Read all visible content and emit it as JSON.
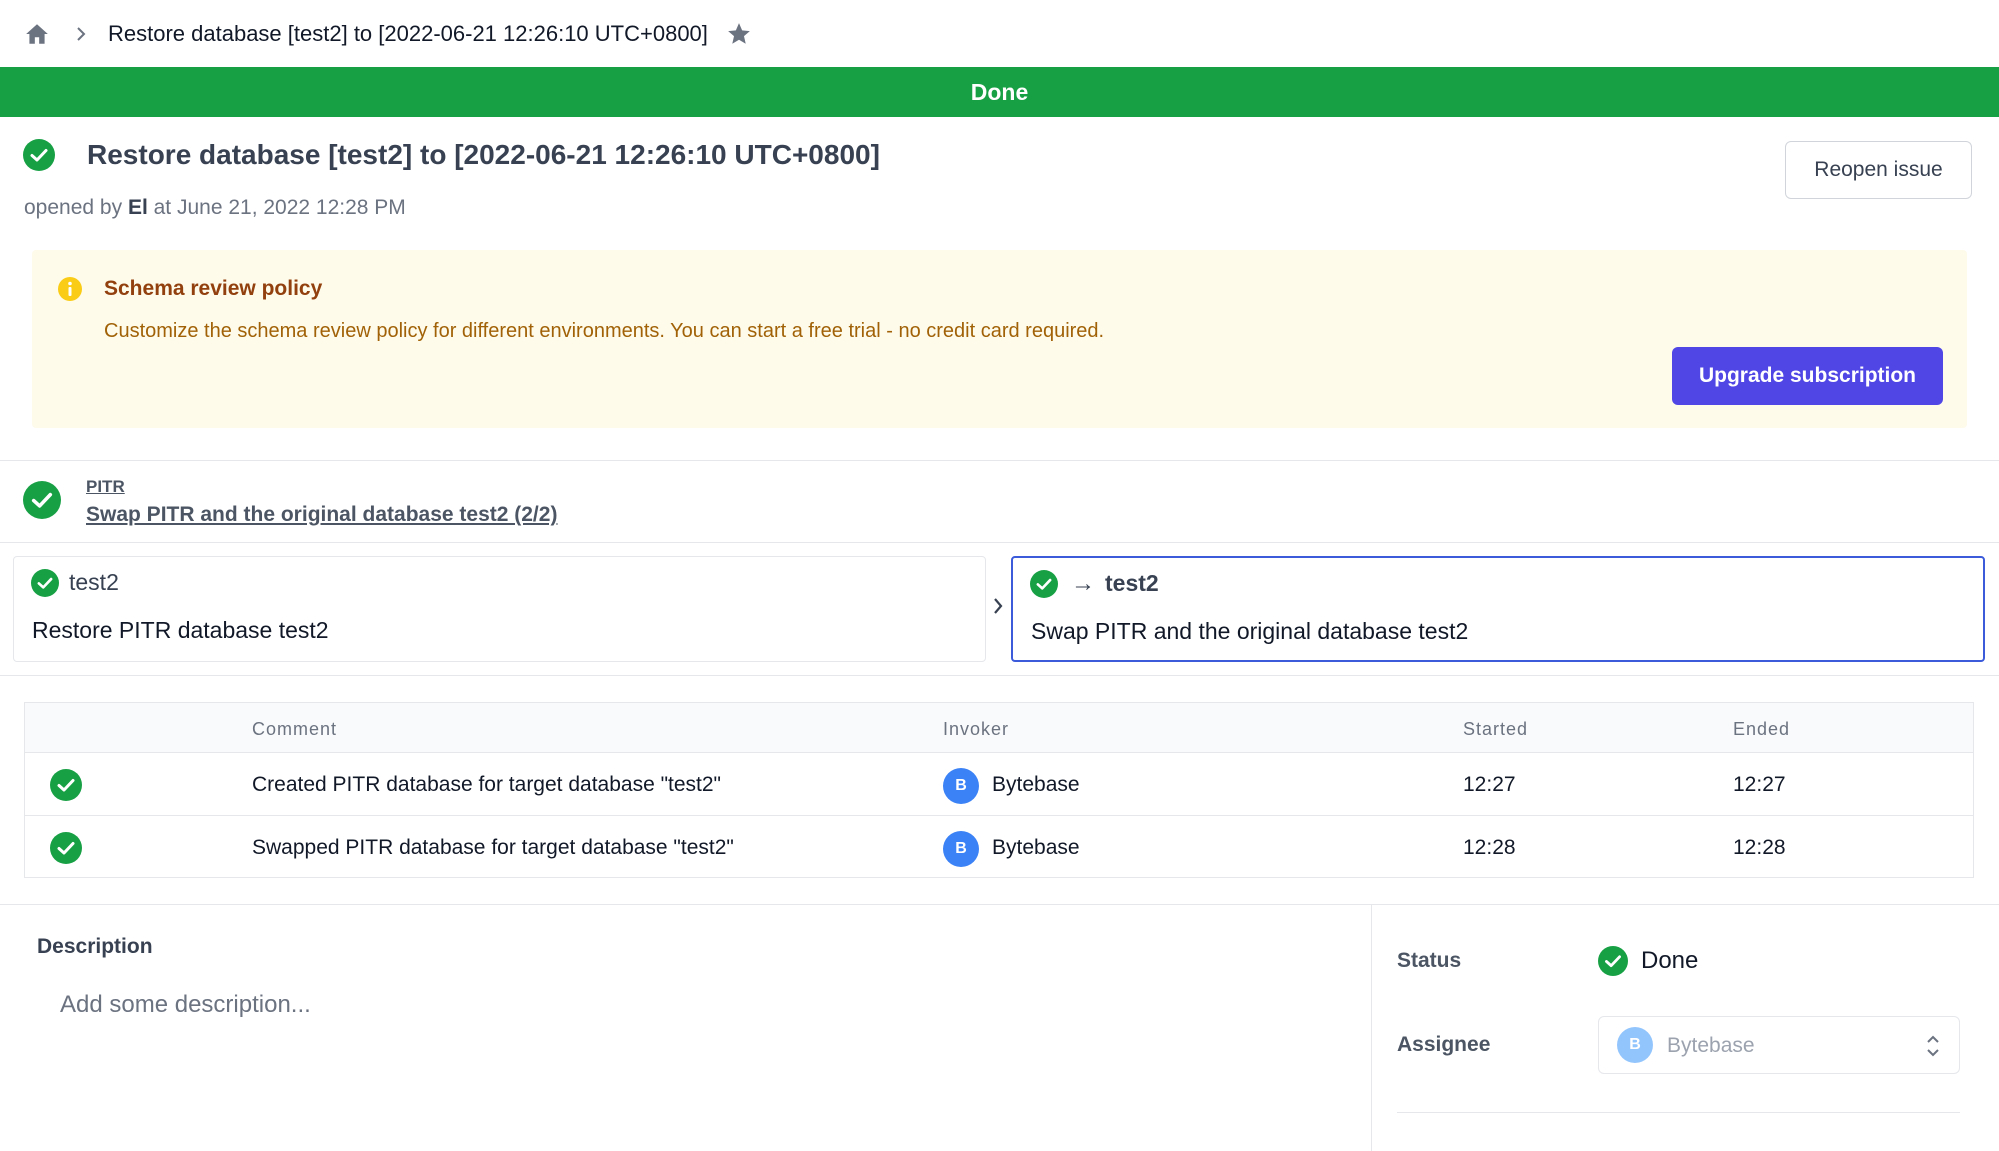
{
  "breadcrumb": {
    "current": "Restore database [test2] to [2022-06-21 12:26:10 UTC+0800]"
  },
  "banner": {
    "status": "Done"
  },
  "issue": {
    "title": "Restore database [test2] to [2022-06-21 12:26:10 UTC+0800]",
    "opened_prefix": "opened by ",
    "author": "El",
    "opened_suffix": " at June 21, 2022 12:28 PM",
    "reopen_label": "Reopen issue"
  },
  "policy": {
    "title": "Schema review policy",
    "text": "Customize the schema review policy for different environments. You can start a free trial - no credit card required.",
    "upgrade_label": "Upgrade subscription"
  },
  "stage": {
    "label": "PITR",
    "name": "Swap PITR and the original database test2 (2/2)"
  },
  "tasks": [
    {
      "database": "test2",
      "name": "Restore PITR database test2",
      "arrow": ""
    },
    {
      "database": "test2",
      "name": "Swap PITR and the original database test2",
      "arrow": "→"
    }
  ],
  "runs": {
    "headers": {
      "comment": "Comment",
      "invoker": "Invoker",
      "started": "Started",
      "ended": "Ended"
    },
    "rows": [
      {
        "comment": "Created PITR database for target database \"test2\"",
        "avatar": "B",
        "invoker": "Bytebase",
        "started": "12:27",
        "ended": "12:27"
      },
      {
        "comment": "Swapped PITR database for target database \"test2\"",
        "avatar": "B",
        "invoker": "Bytebase",
        "started": "12:28",
        "ended": "12:28"
      }
    ]
  },
  "description": {
    "label": "Description",
    "placeholder": "Add some description..."
  },
  "sidebar": {
    "status_label": "Status",
    "status_value": "Done",
    "assignee_label": "Assignee",
    "assignee_avatar": "B",
    "assignee_value": "Bytebase"
  },
  "colors": {
    "done_green": "#18a045",
    "accent_indigo": "#4f46e5",
    "policy_bg": "#fefbeb"
  },
  "icons": [
    "home-icon",
    "chevron-right-icon",
    "star-icon",
    "check-circle-icon",
    "info-icon",
    "arrow-right-icon",
    "select-updown-icon"
  ]
}
